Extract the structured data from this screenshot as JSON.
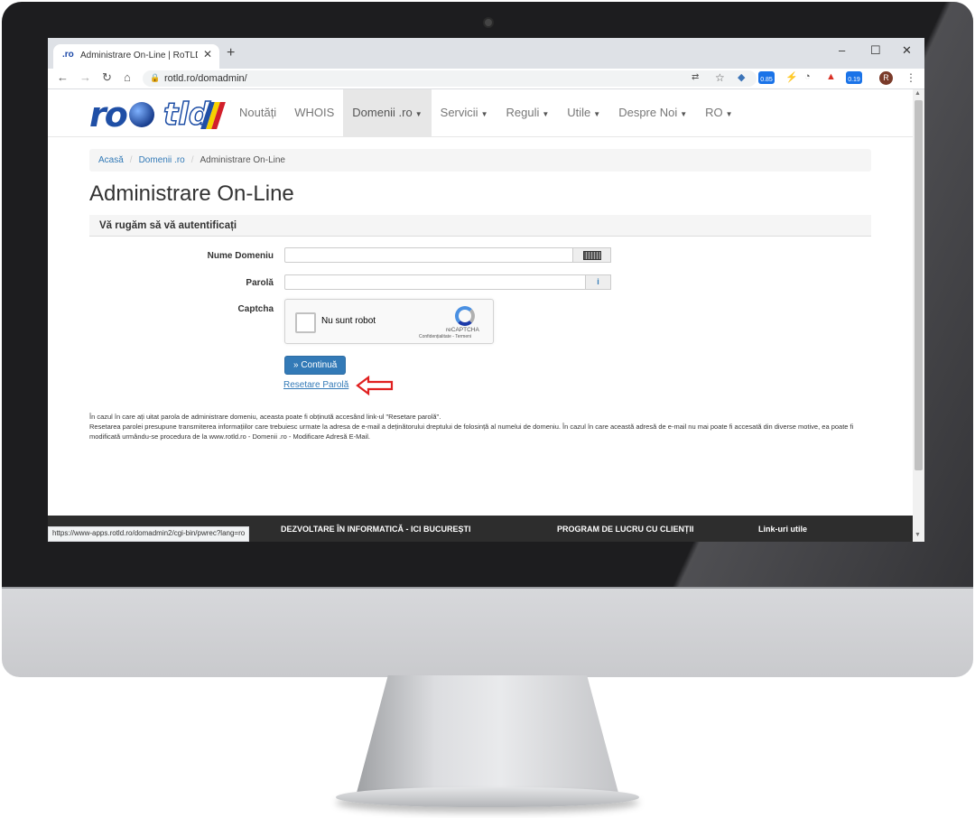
{
  "browser": {
    "tab_favicon": ".ro",
    "tab_title": "Administrare On-Line | RoTLD - R",
    "tab_close": "✕",
    "new_tab": "+",
    "window_controls": {
      "minimize": "–",
      "maximize": "☐",
      "close": "✕"
    },
    "nav": {
      "back": "←",
      "forward": "→",
      "reload": "↻",
      "home": "⌂"
    },
    "url": "rotld.ro/domadmin/",
    "extension_badges": [
      "0.85",
      "0.19"
    ],
    "profile_initial": "R",
    "menu_dots": "⋮",
    "status_url": "https://www-apps.rotld.ro/domadmin2/cgi-bin/pwrec?lang=ro"
  },
  "site": {
    "logo_text": "ro",
    "logo_tld": "tld",
    "menu": [
      {
        "label": "Noutăți",
        "dropdown": false
      },
      {
        "label": "WHOIS",
        "dropdown": false
      },
      {
        "label": "Domenii .ro",
        "dropdown": true,
        "active": true
      },
      {
        "label": "Servicii",
        "dropdown": true
      },
      {
        "label": "Reguli",
        "dropdown": true
      },
      {
        "label": "Utile",
        "dropdown": true
      },
      {
        "label": "Despre Noi",
        "dropdown": true
      },
      {
        "label": "RO",
        "dropdown": true
      }
    ],
    "breadcrumb": [
      "Acasă",
      "Domenii .ro",
      "Administrare On-Line"
    ],
    "page_title": "Administrare On-Line",
    "panel_heading": "Vă rugăm să vă autentificați",
    "form": {
      "domain_label": "Nume Domeniu",
      "password_label": "Parolă",
      "captcha_label": "Captcha",
      "password_addon": "i"
    },
    "captcha": {
      "checkbox_label": "Nu sunt robot",
      "brand": "reCAPTCHA",
      "terms": "Confidențialitate - Termeni"
    },
    "submit_button": "» Continuă",
    "reset_link": "Resetare Parolă",
    "help_text": [
      "În cazul în care ați uitat parola de administrare domeniu, aceasta poate fi obținută accesând link-ul \"Resetare parolă\".",
      "Resetarea parolei presupune transmiterea informațiilor care trebuiesc urmate la adresa de e-mail a deținătorului dreptului de folosință al numelui de domeniu. În cazul în care această adresă de e-mail nu mai poate fi accesată din diverse motive, ea poate fi modificată urmându-se procedura de la www.rotld.ro - Domenii .ro - Modificare Adresă E-Mail."
    ],
    "footer": [
      "DEZVOLTARE ÎN INFORMATICĂ - ICI BUCUREȘTI",
      "PROGRAM DE LUCRU CU CLIENȚII",
      "Link-uri utile"
    ]
  },
  "colors": {
    "accent": "#337ab7",
    "annotation_arrow": "#e02020",
    "logo": "#1f4fa6"
  }
}
